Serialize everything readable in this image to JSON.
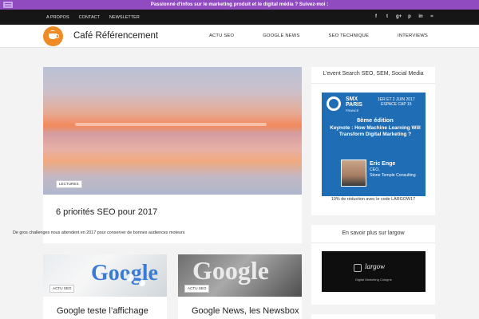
{
  "promo_bar": {
    "text": "Passionné d'infos sur le marketing produit et le digital média ? Suivez-moi :"
  },
  "top_nav": [
    "A PROPOS",
    "CONTACT",
    "NEWSLETTER"
  ],
  "social": [
    {
      "icon": "facebook-icon",
      "glyph": "f"
    },
    {
      "icon": "twitter-icon",
      "glyph": "t"
    },
    {
      "icon": "google-plus-icon",
      "glyph": "g+"
    },
    {
      "icon": "pinterest-icon",
      "glyph": "p"
    },
    {
      "icon": "linkedin-icon",
      "glyph": "in"
    },
    {
      "icon": "rss-icon",
      "glyph": "≈"
    }
  ],
  "header": {
    "site_title": "Café Référencement",
    "nav": [
      "ACTU SEO",
      "GOOGLE NEWS",
      "SEO TECHNIQUE",
      "INTERVIEWS"
    ]
  },
  "featured": {
    "tag": "LECTURES",
    "title": "6 priorités SEO pour 2017",
    "excerpt": "De gros challenges nous attendent en 2017 pour conserver de bonnes audiences moteurs"
  },
  "posts": [
    {
      "tag": "ACTU SEO",
      "title": "Google teste l’affichage",
      "image_word": "Google"
    },
    {
      "tag": "ACTU SEO",
      "title": "Google News, les Newsbox",
      "image_word": "Google"
    }
  ],
  "sidebar": {
    "widget1": {
      "title": "L’event Search SEO, SEM, Social Media",
      "banner": {
        "brand": "SMX",
        "city": "PARIS",
        "country": "FRANCE",
        "date_line1": "1ER ET 2 JUIN 2017",
        "date_line2": "ESPACE CAP 15",
        "edition": "8ème édition",
        "keynote": "Keynote : How Machine Learning Will Transform Digital Marketing ?",
        "speaker_name": "Eric Enge",
        "speaker_role": "CEO,",
        "speaker_company": "Stone Temple Consulting"
      },
      "promo_code": "10% de réduction avec le code LARGOW17"
    },
    "widget2": {
      "title": "En savoir plus sur largow",
      "banner": {
        "name": "largow",
        "subtitle": "Digital Marketing Cologne"
      }
    }
  },
  "colors": {
    "promo": "#8f4bbf",
    "topbar": "#161616",
    "logo": "#f08a24",
    "smx_blue": "#1f6db5"
  }
}
